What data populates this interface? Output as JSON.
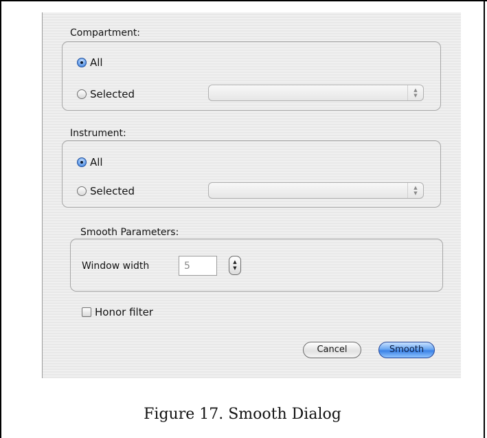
{
  "compartment": {
    "title": "Compartment:",
    "options": [
      {
        "label": "All",
        "selected": true
      },
      {
        "label": "Selected",
        "selected": false
      }
    ],
    "popup_value": ""
  },
  "instrument": {
    "title": "Instrument:",
    "options": [
      {
        "label": "All",
        "selected": true
      },
      {
        "label": "Selected",
        "selected": false
      }
    ],
    "popup_value": ""
  },
  "smooth": {
    "title": "Smooth Parameters:",
    "window_width_label": "Window width",
    "window_width_value": "5"
  },
  "honor_filter": {
    "label": "Honor filter",
    "checked": false
  },
  "buttons": {
    "cancel": "Cancel",
    "smooth": "Smooth"
  },
  "caption": "Figure 17.  Smooth Dialog",
  "colors": {
    "default_button": "#3b82e6",
    "selected_radio": "#2f74d6"
  }
}
